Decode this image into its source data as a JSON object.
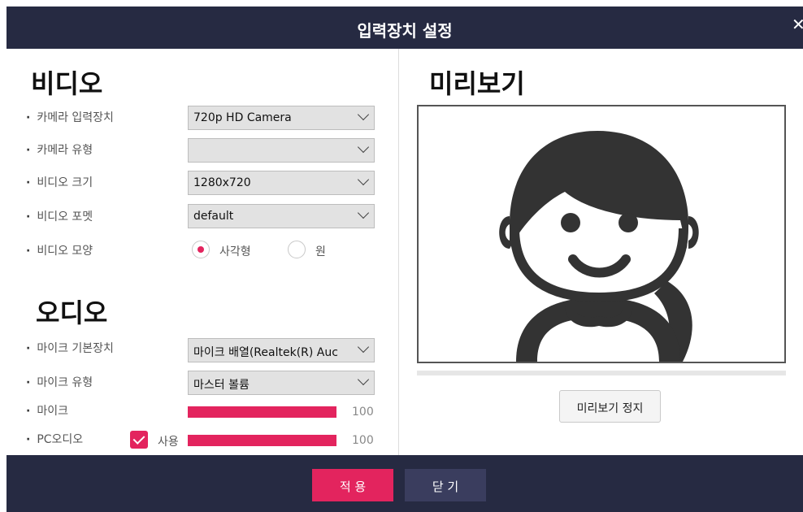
{
  "dialog": {
    "title": "입력장치 설정",
    "close_glyph": "✕"
  },
  "video": {
    "section_title": "비디오",
    "fields": [
      {
        "label": "카메라 입력장치",
        "value": "720p HD Camera"
      },
      {
        "label": "카메라 유형",
        "value": ""
      },
      {
        "label": "비디오 크기",
        "value": "1280x720"
      },
      {
        "label": "비디오 포멧",
        "value": "default"
      }
    ],
    "shape": {
      "label": "비디오 모양",
      "options": [
        {
          "label": "사각형",
          "selected": true
        },
        {
          "label": "원",
          "selected": false
        }
      ]
    }
  },
  "audio": {
    "section_title": "오디오",
    "fields": [
      {
        "label": "마이크 기본장치",
        "value": "마이크 배열(Realtek(R) Auc"
      },
      {
        "label": "마이크 유형",
        "value": "마스터 볼륨"
      }
    ],
    "mic": {
      "label": "마이크",
      "level": 100,
      "level_text": "100"
    },
    "pc_audio": {
      "label": "PC오디오",
      "use_label": "사용",
      "checked": true,
      "level": 100,
      "level_text": "100"
    }
  },
  "preview": {
    "section_title": "미리보기",
    "stop_label": "미리보기 정지"
  },
  "footer": {
    "apply_label": "적 용",
    "close_label": "닫 기"
  },
  "colors": {
    "accent": "#e3245e",
    "header_bg": "#262a42",
    "close_btn_bg": "#3a3d5e"
  },
  "icons": {
    "dropdown": "chevron-down-icon",
    "check": "check-icon",
    "avatar": "person-avatar-icon"
  }
}
